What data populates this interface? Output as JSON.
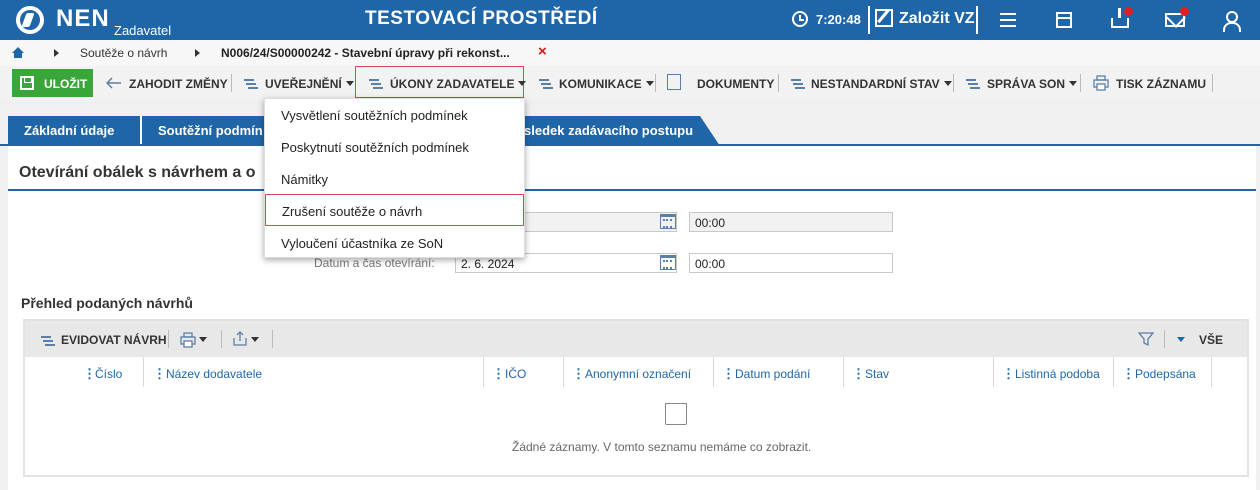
{
  "header": {
    "logo": "NEN",
    "logo_sub": "Zadavatel",
    "env_title": "TESTOVACÍ PROSTŘEDÍ",
    "clock": "7:20:48",
    "create_label": "Založit VZ",
    "colors": {
      "bar": "#1f66a8",
      "badge": "#e02020"
    }
  },
  "breadcrumb": {
    "items": [
      "Soutěže o návrh",
      "N006/24/S00000242 - Stavební úpravy při rekonst..."
    ],
    "close_icon": "×"
  },
  "toolbar": {
    "save": "ULOŽIT",
    "discard": "ZAHODIT ZMĚNY",
    "publish": "UVEŘEJNĚNÍ",
    "acts": "ÚKONY ZADAVATELE",
    "communication": "KOMUNIKACE",
    "documents": "DOKUMENTY",
    "nonstandard": "NESTANDARDNÍ STAV",
    "son_admin": "SPRÁVA SON",
    "print": "TISK ZÁZNAMU"
  },
  "tabs": [
    "Základní údaje",
    "Soutěžní podmín",
    "sledek zadávacího postupu"
  ],
  "section": {
    "title": "Otevírání obálek s návrhem a o",
    "fields": {
      "row1_time": "00:00",
      "open_label": "Datum a čas otevírání:",
      "open_date": "2. 6. 2024",
      "open_time": "00:00"
    }
  },
  "list": {
    "title": "Přehled podaných návrhů",
    "record_button": "EVIDOVAT NÁVRH",
    "all_label": "VŠE",
    "columns": [
      "Číslo",
      "Název dodavatele",
      "IČO",
      "Anonymní označení",
      "Datum podání",
      "Stav",
      "Listinná podoba",
      "Podepsána"
    ],
    "empty": "Žádné záznamy. V tomto seznamu nemáme co zobrazit."
  },
  "dropdown": {
    "items": [
      "Vysvětlení soutěžních podmínek",
      "Poskytnutí soutěžních podmínek",
      "Námitky",
      "Zrušení soutěže o návrh",
      "Vyloučení účastníka ze SoN"
    ]
  }
}
